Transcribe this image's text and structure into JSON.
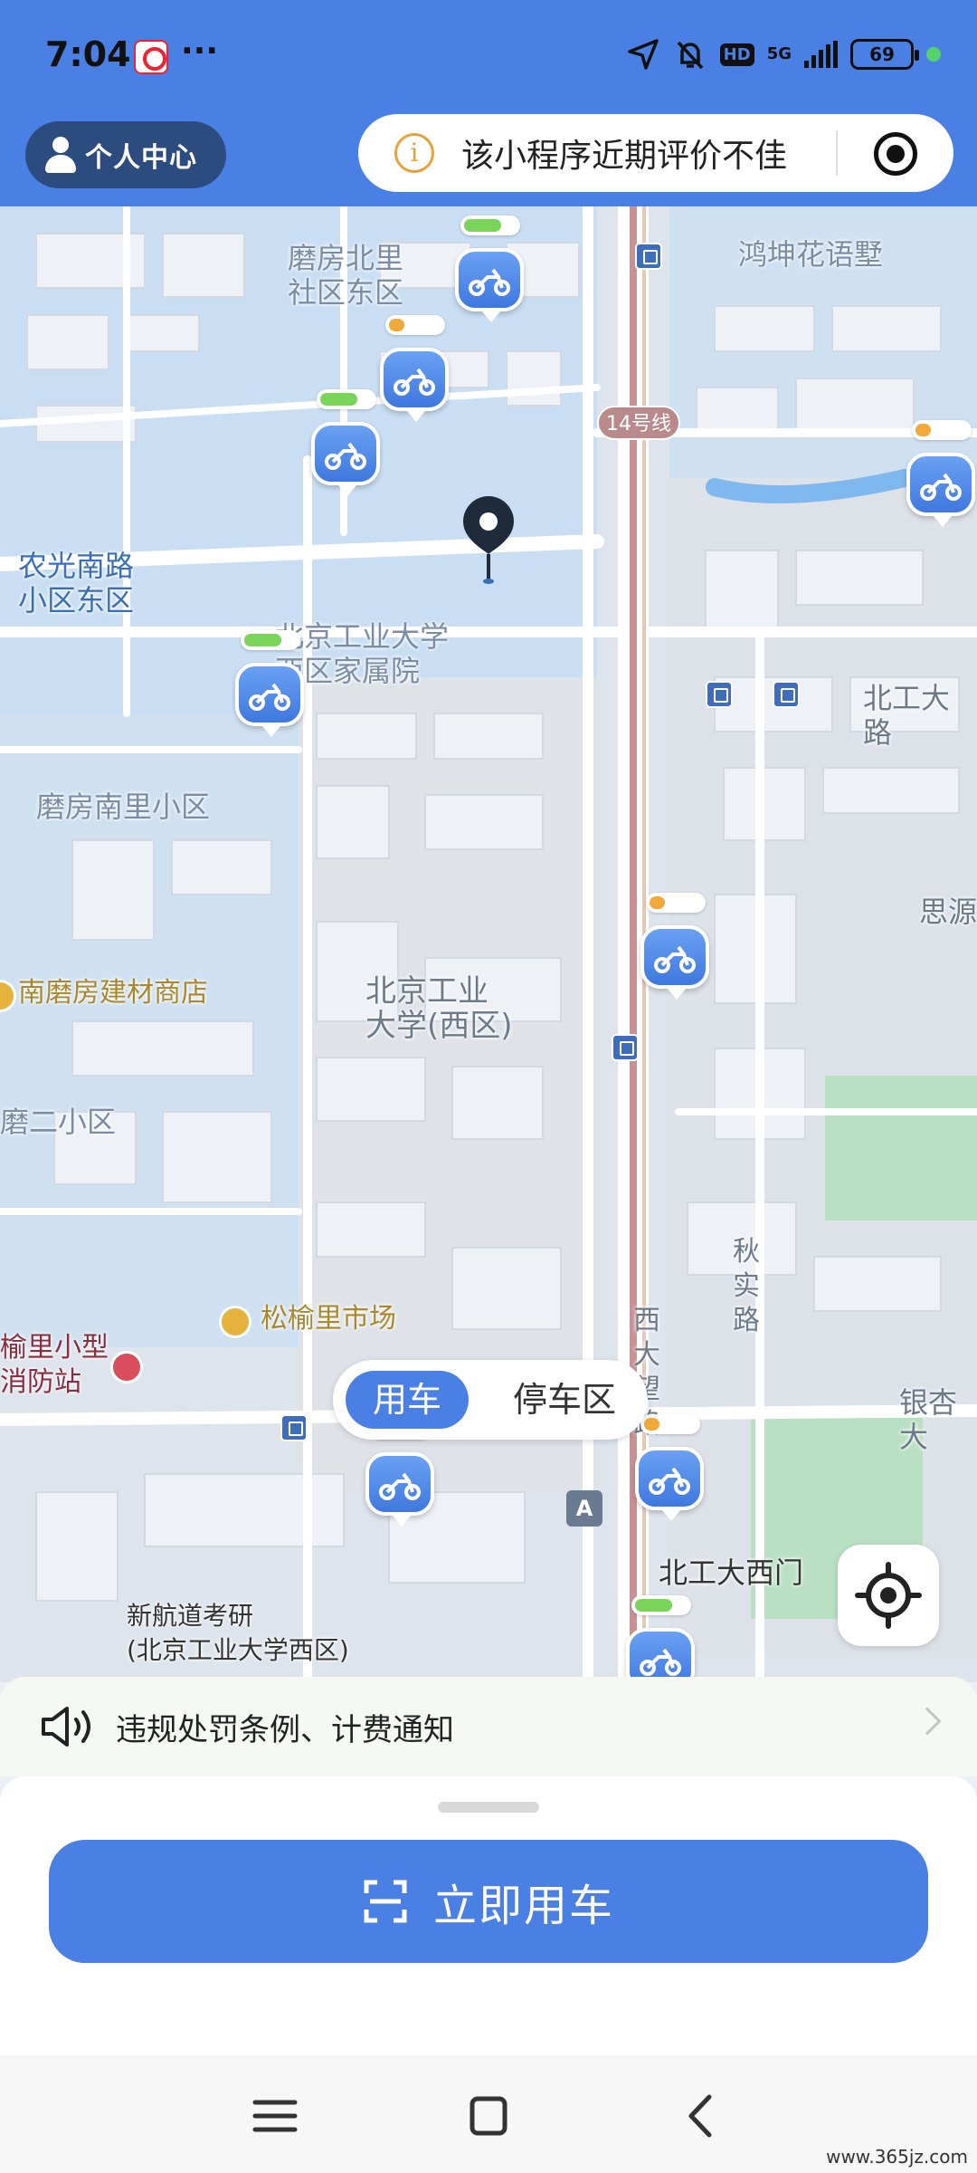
{
  "status_bar": {
    "time": "7:04",
    "more": "···",
    "hd_badge": "HD",
    "network": "5G",
    "battery": "69"
  },
  "header": {
    "profile_label": "个人中心",
    "notice_text": "该小程序近期评价不佳",
    "info_icon": "i"
  },
  "map": {
    "places": [
      "磨房北里\n社区东区",
      "鸿坤花语墅",
      "农光南路\n小区东区",
      "北京工业大学\n西区家属院",
      "北工大路",
      "磨房南里小区",
      "思源",
      "南磨房建材商店",
      "北京工业\n大学(西区)",
      "磨二小区",
      "秋\n实\n路",
      "松榆里市场",
      "榆里小型\n消防站",
      "西\n大\n望\n路",
      "银杏大",
      "北工大西门",
      "新航道考研\n(北京工业大学西区)"
    ],
    "metro_line": "14号线",
    "a_marker": "A"
  },
  "toggle": {
    "use_bike": "用车",
    "parking": "停车区"
  },
  "notice_bar": {
    "text": "违规处罚条例、计费通知"
  },
  "primary_action": {
    "label": "立即用车"
  },
  "watermark": "www.365jz.com",
  "colors": {
    "brand_blue": "#4a7fe3",
    "header_pill_dark": "#2c4c7f",
    "battery_green": "#7bd45a",
    "battery_orange": "#f2a93b",
    "battery_red": "#e5484d"
  },
  "bikes": [
    {
      "battery": 0.7,
      "color": "#7bd45a"
    },
    {
      "battery": 0.3,
      "color": "#f2a93b"
    },
    {
      "battery": 0.7,
      "color": "#7bd45a"
    },
    {
      "battery": 0.3,
      "color": "#f2a93b"
    },
    {
      "battery": 0.7,
      "color": "#7bd45a"
    },
    {
      "battery": 0.3,
      "color": "#f2a93b"
    },
    {
      "battery": 0.15,
      "color": "#e5484d"
    },
    {
      "battery": 0.3,
      "color": "#f2a93b"
    },
    {
      "battery": 0.3,
      "color": "#f2a93b"
    },
    {
      "battery": 0.7,
      "color": "#7bd45a"
    }
  ]
}
